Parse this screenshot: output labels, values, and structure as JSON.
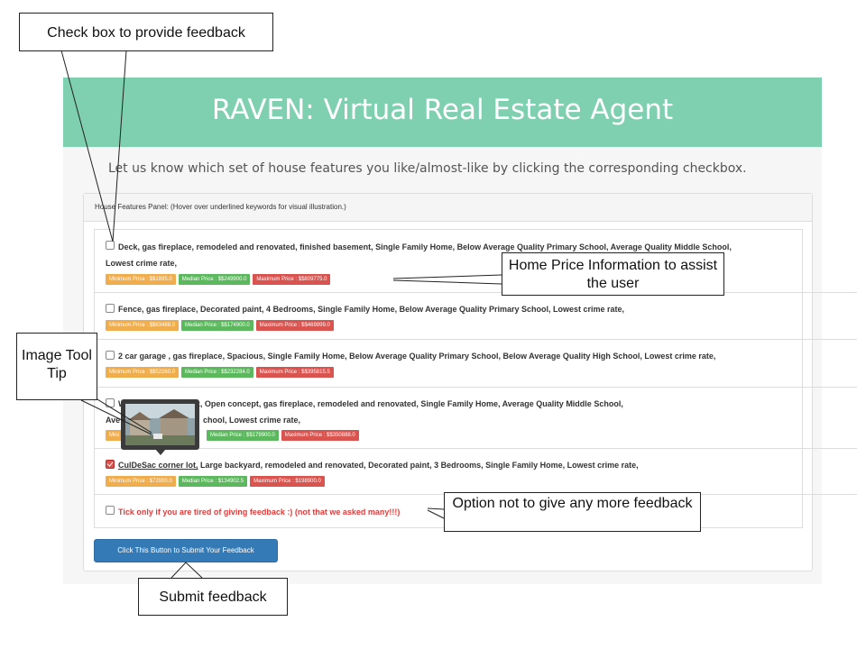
{
  "header": {
    "title": "RAVEN: Virtual Real Estate Agent"
  },
  "intro": "Let us know which set of house features you like/almost-like by clicking the corresponding checkbox.",
  "panel": {
    "heading": "House Features Panel: (Hover over underlined keywords for visual illustration.)"
  },
  "rows": [
    {
      "line1": "Deck, gas fireplace, remodeled and renovated, finished basement, Single Family Home, Below Average Quality Primary School, Average Quality Middle School,",
      "line2": "Lowest crime rate,",
      "min": "Minimum Price : $$1995.0",
      "median": "Median Price : $$249900.0",
      "max": "Maximum Price : $$809775.0",
      "checked": false
    },
    {
      "line1": "Fence, gas fireplace, Decorated paint, 4 Bedrooms, Single Family Home, Below Average Quality Primary School, Lowest crime rate,",
      "min": "Minimum Price : $$63488.0",
      "median": "Median Price : $$174900.0",
      "max": "Maximum Price : $$469999.0",
      "checked": false
    },
    {
      "line1": "2 car garage , gas fireplace, Spacious, Single Family Home, Below Average Quality Primary School, Below Average Quality High School, Lowest crime rate,",
      "min": "Minimum Price : $$52260.0",
      "median": "Median Price : $$232284.0",
      "max": "Maximum Price : $$395815.5",
      "checked": false
    },
    {
      "line1_start": "Wood fireplace, Deck, Open concept, gas fireplace, remodeled and renovated, Single Family Home, Average Quality Middle School,",
      "line2": "chool, Lowest crime rate,",
      "line2_prefix": "Ave",
      "min_prefix": "Mini",
      "median": "Median Price : $$179900.0",
      "max": "Maximum Price : $$350888.0",
      "checked": false
    },
    {
      "underlined": "CulDeSac corner lot,",
      "line1": " Large backyard, remodeled and renovated, Decorated paint, 3 Bedrooms, Single Family Home, Lowest crime rate,",
      "min": "Minimum Price : $72000.0",
      "median": "Median Price : $134902.5",
      "max": "Maximum Price : $198900.0",
      "checked": true
    }
  ],
  "optout": "Tick only if you are tired of giving feedback :) (not that we asked many!!!)",
  "submit_label": "Click This Button to Submit Your Feedback",
  "callouts": {
    "checkbox": "Check box to provide feedback",
    "price": "Home Price Information to assist the user",
    "tooltip": "Image Tool Tip",
    "optout": "Option not to give any more feedback",
    "submit": "Submit feedback"
  },
  "colors": {
    "banner": "#7fcfb1",
    "min_badge": "#f0ad4e",
    "median_badge": "#5cb85c",
    "max_badge": "#d9534f",
    "submit": "#337ab7"
  }
}
